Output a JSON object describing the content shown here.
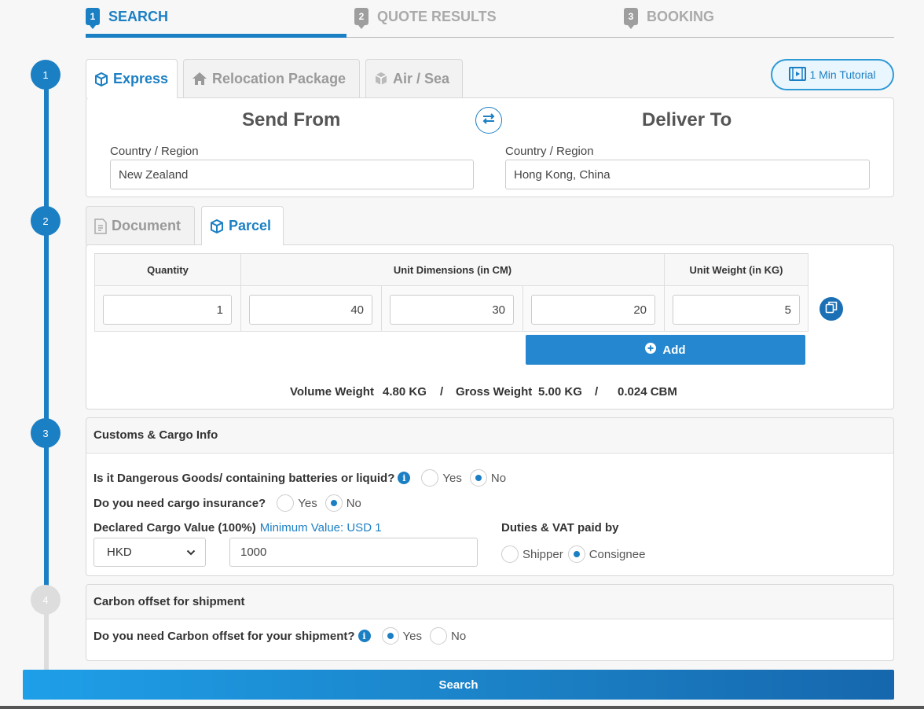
{
  "steps": [
    {
      "num": "1",
      "label": "SEARCH"
    },
    {
      "num": "2",
      "label": "QUOTE RESULTS"
    },
    {
      "num": "3",
      "label": "BOOKING"
    }
  ],
  "timeline": [
    "1",
    "2",
    "3",
    "4"
  ],
  "shipping_tabs": [
    "Express",
    "Relocation Package",
    "Air / Sea"
  ],
  "tutorial_label": "1 Min Tutorial",
  "send_from": {
    "title": "Send From",
    "country_label": "Country / Region",
    "country_value": "New Zealand"
  },
  "deliver_to": {
    "title": "Deliver To",
    "country_label": "Country / Region",
    "country_value": "Hong Kong, China"
  },
  "package_tabs": [
    "Document",
    "Parcel"
  ],
  "parcel_table": {
    "headers": {
      "quantity": "Quantity",
      "dimensions": "Unit Dimensions (in CM)",
      "weight": "Unit Weight (in KG)"
    },
    "row": {
      "quantity": "1",
      "length": "40",
      "width": "30",
      "height": "20",
      "weight": "5"
    }
  },
  "add_label": "Add",
  "weights": {
    "volume_label": "Volume Weight",
    "volume_value": "4.80 KG",
    "sep1": "/",
    "gross_label": "Gross Weight",
    "gross_value": "5.00 KG",
    "sep2": "/",
    "cbm": "0.024 CBM"
  },
  "customs": {
    "title": "Customs & Cargo Info",
    "dangerous_q": "Is it Dangerous Goods/ containing batteries or liquid?",
    "insurance_q": "Do you need cargo insurance?",
    "yes": "Yes",
    "no": "No",
    "declared_label": "Declared Cargo Value (100%)",
    "min_value": "Minimum Value: USD 1",
    "currency": "HKD",
    "declared_value": "1000",
    "duties_label": "Duties & VAT paid by",
    "shipper": "Shipper",
    "consignee": "Consignee"
  },
  "carbon": {
    "title": "Carbon offset for shipment",
    "question": "Do you need Carbon offset for your shipment?",
    "yes": "Yes",
    "no": "No"
  },
  "search_label": "Search",
  "colors": {
    "accent": "#1b7fc4",
    "inactive": "#9e9e9e"
  }
}
